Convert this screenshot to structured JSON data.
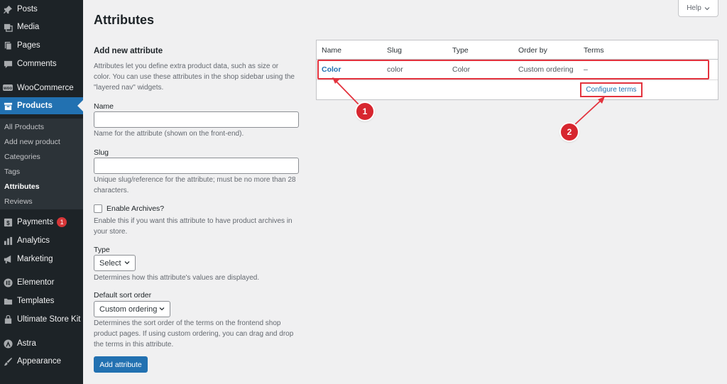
{
  "sidebar": {
    "items": [
      {
        "label": "Posts",
        "icon": "pushpin-icon"
      },
      {
        "label": "Media",
        "icon": "media-icon"
      },
      {
        "label": "Pages",
        "icon": "pages-icon"
      },
      {
        "label": "Comments",
        "icon": "comment-icon"
      },
      {
        "label": "WooCommerce",
        "icon": "woo-icon"
      },
      {
        "label": "Products",
        "icon": "archive-icon"
      },
      {
        "label": "Payments",
        "icon": "payments-icon",
        "badge": "1"
      },
      {
        "label": "Analytics",
        "icon": "chart-bar-icon"
      },
      {
        "label": "Marketing",
        "icon": "megaphone-icon"
      },
      {
        "label": "Elementor",
        "icon": "elementor-icon"
      },
      {
        "label": "Templates",
        "icon": "folder-icon"
      },
      {
        "label": "Ultimate Store Kit",
        "icon": "bag-icon"
      },
      {
        "label": "Astra",
        "icon": "astra-icon"
      },
      {
        "label": "Appearance",
        "icon": "paintbrush-icon"
      }
    ],
    "submenu": [
      "All Products",
      "Add new product",
      "Categories",
      "Tags",
      "Attributes",
      "Reviews"
    ]
  },
  "page": {
    "title": "Attributes",
    "help_label": "Help"
  },
  "form": {
    "heading": "Add new attribute",
    "intro": "Attributes let you define extra product data, such as size or color. You can use these attributes in the shop sidebar using the \"layered nav\" widgets.",
    "name_label": "Name",
    "name_value": "",
    "name_help": "Name for the attribute (shown on the front-end).",
    "slug_label": "Slug",
    "slug_value": "",
    "slug_help": "Unique slug/reference for the attribute; must be no more than 28 characters.",
    "archives_label": "Enable Archives?",
    "archives_help": "Enable this if you want this attribute to have product archives in your store.",
    "type_label": "Type",
    "type_value": "Select",
    "type_help": "Determines how this attribute's values are displayed.",
    "sort_label": "Default sort order",
    "sort_value": "Custom ordering",
    "sort_help": "Determines the sort order of the terms on the frontend shop product pages. If using custom ordering, you can drag and drop the terms in this attribute.",
    "submit_label": "Add attribute"
  },
  "table": {
    "headers": [
      "Name",
      "Slug",
      "Type",
      "Order by",
      "Terms"
    ],
    "row": {
      "name": "Color",
      "slug": "color",
      "type": "Color",
      "order_by": "Custom ordering",
      "terms": "–"
    },
    "configure_label": "Configure terms"
  },
  "callouts": [
    "1",
    "2"
  ],
  "colors": {
    "sidebar_bg": "#1d2327",
    "accent": "#2271b1",
    "highlight": "#e3333e",
    "badge": "#d63638"
  }
}
